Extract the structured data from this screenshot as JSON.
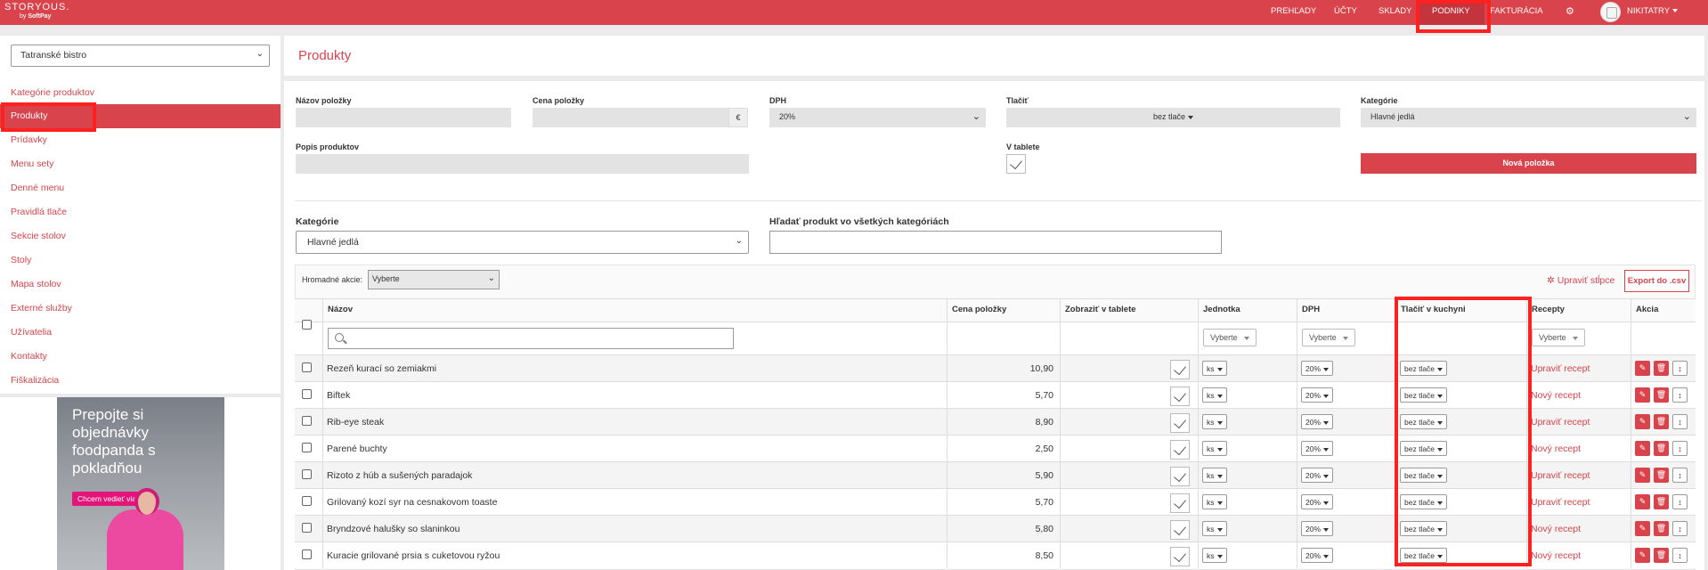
{
  "brand": {
    "name": "STORYOUS.",
    "by": "by",
    "by_brand": "SoftPay"
  },
  "nav": {
    "items": [
      "PREHĽADY",
      "ÚČTY",
      "SKLADY",
      "PODNIKY",
      "FAKTURÁCIA"
    ],
    "active": "PODNIKY",
    "user": "NIKITATRY"
  },
  "sidebar": {
    "venue": "Tatranské bistro",
    "items": [
      "Kategórie produktov",
      "Produkty",
      "Prídavky",
      "Menu sety",
      "Denné menu",
      "Pravidlá tlače",
      "Sekcie stolov",
      "Stoly",
      "Mapa stolov",
      "Externé služby",
      "Užívatelia",
      "Kontakty",
      "Fiškalizácia"
    ],
    "active": "Produkty"
  },
  "ad": {
    "text": "Prepojte si objednávky foodpanda s pokladňou",
    "cta": "Chcem vedieť viac >"
  },
  "page": {
    "title": "Produkty"
  },
  "form": {
    "name_label": "Názov položky",
    "price_label": "Cena položky",
    "currency": "€",
    "vat_label": "DPH",
    "vat_value": "20%",
    "print_label": "Tlačiť",
    "print_value": "bez tlače",
    "category_label": "Kategórie",
    "category_value": "Hlavné jedlá",
    "desc_label": "Popis produktov",
    "tablet_label": "V tablete",
    "new_button": "Nová položka"
  },
  "filters": {
    "category_label": "Kategórie",
    "category_value": "Hlavné jedlá",
    "search_label": "Hľadať produkt vo všetkých kategóriách"
  },
  "toolbar": {
    "bulk_label": "Hromadné akcie:",
    "bulk_value": "Vyberte",
    "edit_columns": "Upraviť stĺpce",
    "export": "Export do .csv"
  },
  "table": {
    "headers": [
      "Názov",
      "Cena položky",
      "Zobraziť v tablete",
      "Jednotka",
      "DPH",
      "Tlačiť v kuchyni",
      "Recepty",
      "Akcia"
    ],
    "filter_placeholder": "Vyberte",
    "rows": [
      {
        "name": "Rezeň kurací so zemiakmi",
        "price": "10,90",
        "unit": "ks",
        "vat": "20%",
        "print": "bez tlače",
        "recipe": "Upraviť recept"
      },
      {
        "name": "Biftek",
        "price": "5,70",
        "unit": "ks",
        "vat": "20%",
        "print": "bez tlače",
        "recipe": "Nový recept"
      },
      {
        "name": "Rib-eye steak",
        "price": "8,90",
        "unit": "ks",
        "vat": "20%",
        "print": "bez tlače",
        "recipe": "Upraviť recept"
      },
      {
        "name": "Parené buchty",
        "price": "2,50",
        "unit": "ks",
        "vat": "20%",
        "print": "bez tlače",
        "recipe": "Nový recept"
      },
      {
        "name": "Rizoto z húb a sušených paradajok",
        "price": "5,90",
        "unit": "ks",
        "vat": "20%",
        "print": "bez tlače",
        "recipe": "Upraviť recept"
      },
      {
        "name": "Grilovaný kozí syr na cesnakovom toaste",
        "price": "5,70",
        "unit": "ks",
        "vat": "20%",
        "print": "bez tlače",
        "recipe": "Upraviť recept"
      },
      {
        "name": "Bryndzové halušky so slaninkou",
        "price": "5,80",
        "unit": "ks",
        "vat": "20%",
        "print": "bez tlače",
        "recipe": "Nový recept"
      },
      {
        "name": "Kuracie grilované prsia s cuketovou ryžou",
        "price": "8,50",
        "unit": "ks",
        "vat": "20%",
        "print": "bez tlače",
        "recipe": "Nový recept"
      }
    ]
  },
  "colors": {
    "accent": "#d9434b",
    "highlight": "#ff2020"
  }
}
